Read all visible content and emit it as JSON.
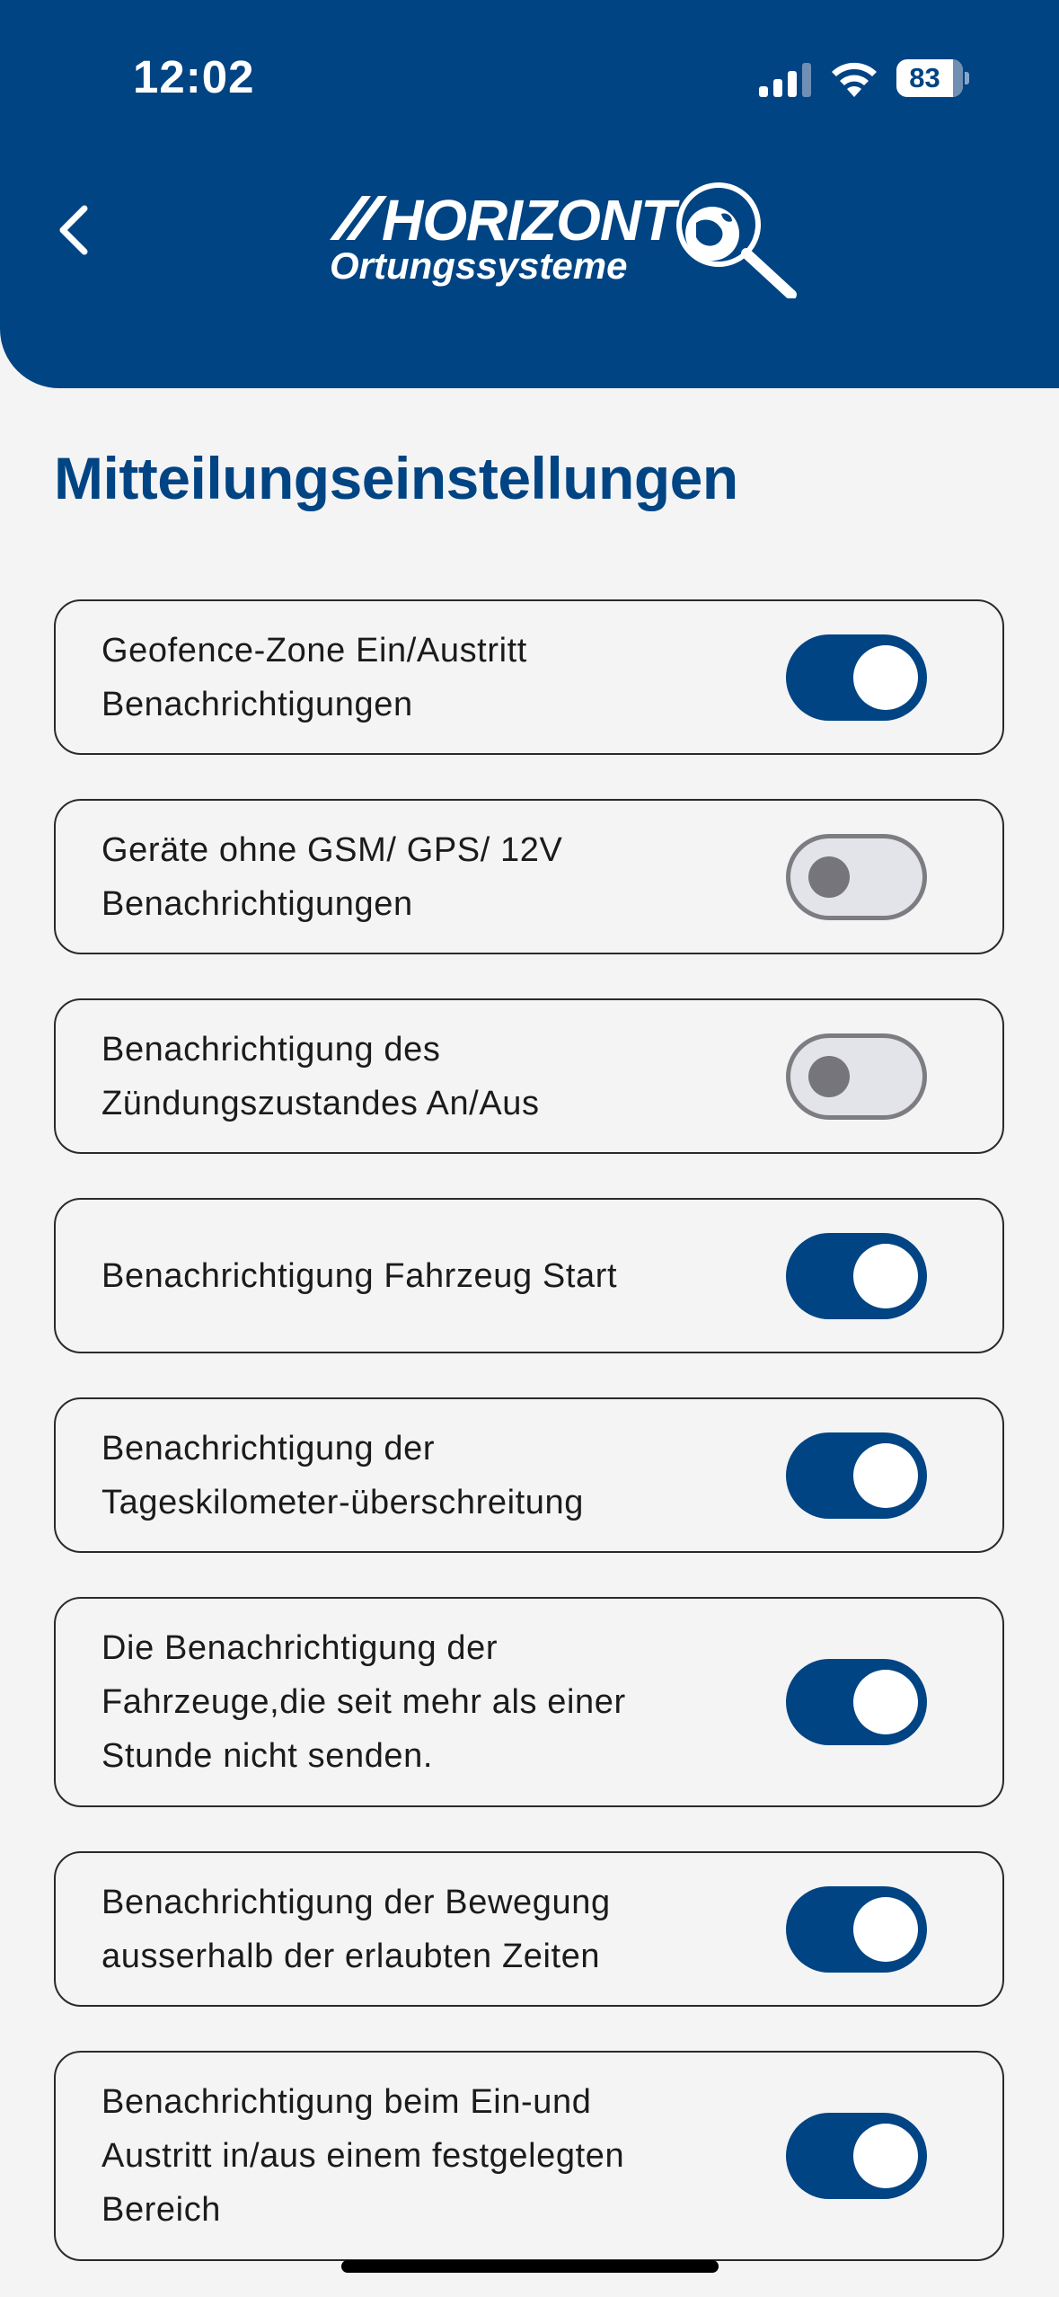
{
  "status_bar": {
    "time": "12:02",
    "battery_level": "83",
    "icons": [
      "signal-icon",
      "wifi-icon",
      "battery-icon"
    ]
  },
  "header": {
    "back_icon": "chevron-left-icon",
    "logo_text_primary": "HORIZONT",
    "logo_text_secondary": "Ortungssysteme",
    "logo_icon": "globe-magnifier-icon"
  },
  "page": {
    "title": "Mitteilungseinstellungen"
  },
  "settings": [
    {
      "label": "Geofence-Zone Ein/Austritt\nBenachrichtigungen",
      "enabled": true
    },
    {
      "label": "Geräte ohne GSM/ GPS/ 12V\nBenachrichtigungen",
      "enabled": false
    },
    {
      "label": "Benachrichtigung des\nZündungszustandes An/Aus",
      "enabled": false
    },
    {
      "label": "Benachrichtigung Fahrzeug Start",
      "enabled": true
    },
    {
      "label": "Benachrichtigung der\nTageskilometer-überschreitung",
      "enabled": true
    },
    {
      "label": "Die Benachrichtigung der\nFahrzeuge,die seit mehr als einer\nStunde nicht senden.",
      "enabled": true
    },
    {
      "label": "Benachrichtigung der Bewegung\nausserhalb der erlaubten Zeiten",
      "enabled": true
    },
    {
      "label": "Benachrichtigung beim Ein-und\nAustritt in/aus einem festgelegten\nBereich",
      "enabled": true
    }
  ],
  "colors": {
    "brand": "#004483",
    "background": "#f4f4f5",
    "toggle_off": "#e3e3ea"
  }
}
